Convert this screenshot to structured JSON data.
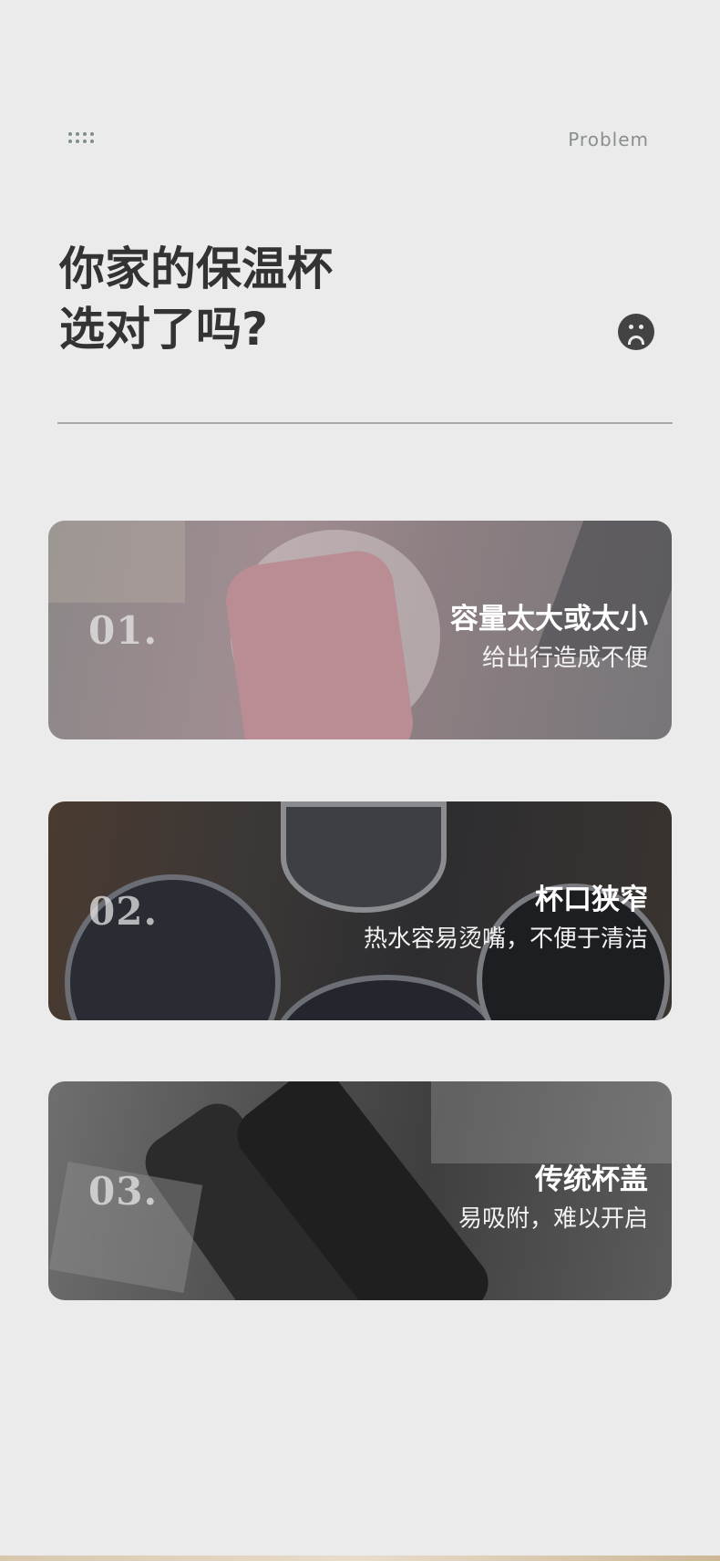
{
  "header": {
    "label": "Problem",
    "icon": "dots-grid-icon"
  },
  "hero": {
    "line1": "你家的保温杯",
    "line2": "选对了吗?",
    "icon": "sad-face-icon"
  },
  "cards": [
    {
      "number": "01.",
      "title": "容量太大或太小",
      "subtitle": "给出行造成不便"
    },
    {
      "number": "02.",
      "title": "杯口狭窄",
      "subtitle": "热水容易烫嘴，不便于清洁"
    },
    {
      "number": "03.",
      "title": "传统杯盖",
      "subtitle": "易吸附，难以开启"
    }
  ],
  "colors": {
    "background": "#ebebeb",
    "heading": "#333333",
    "accent_dots": "#7e8f86"
  }
}
